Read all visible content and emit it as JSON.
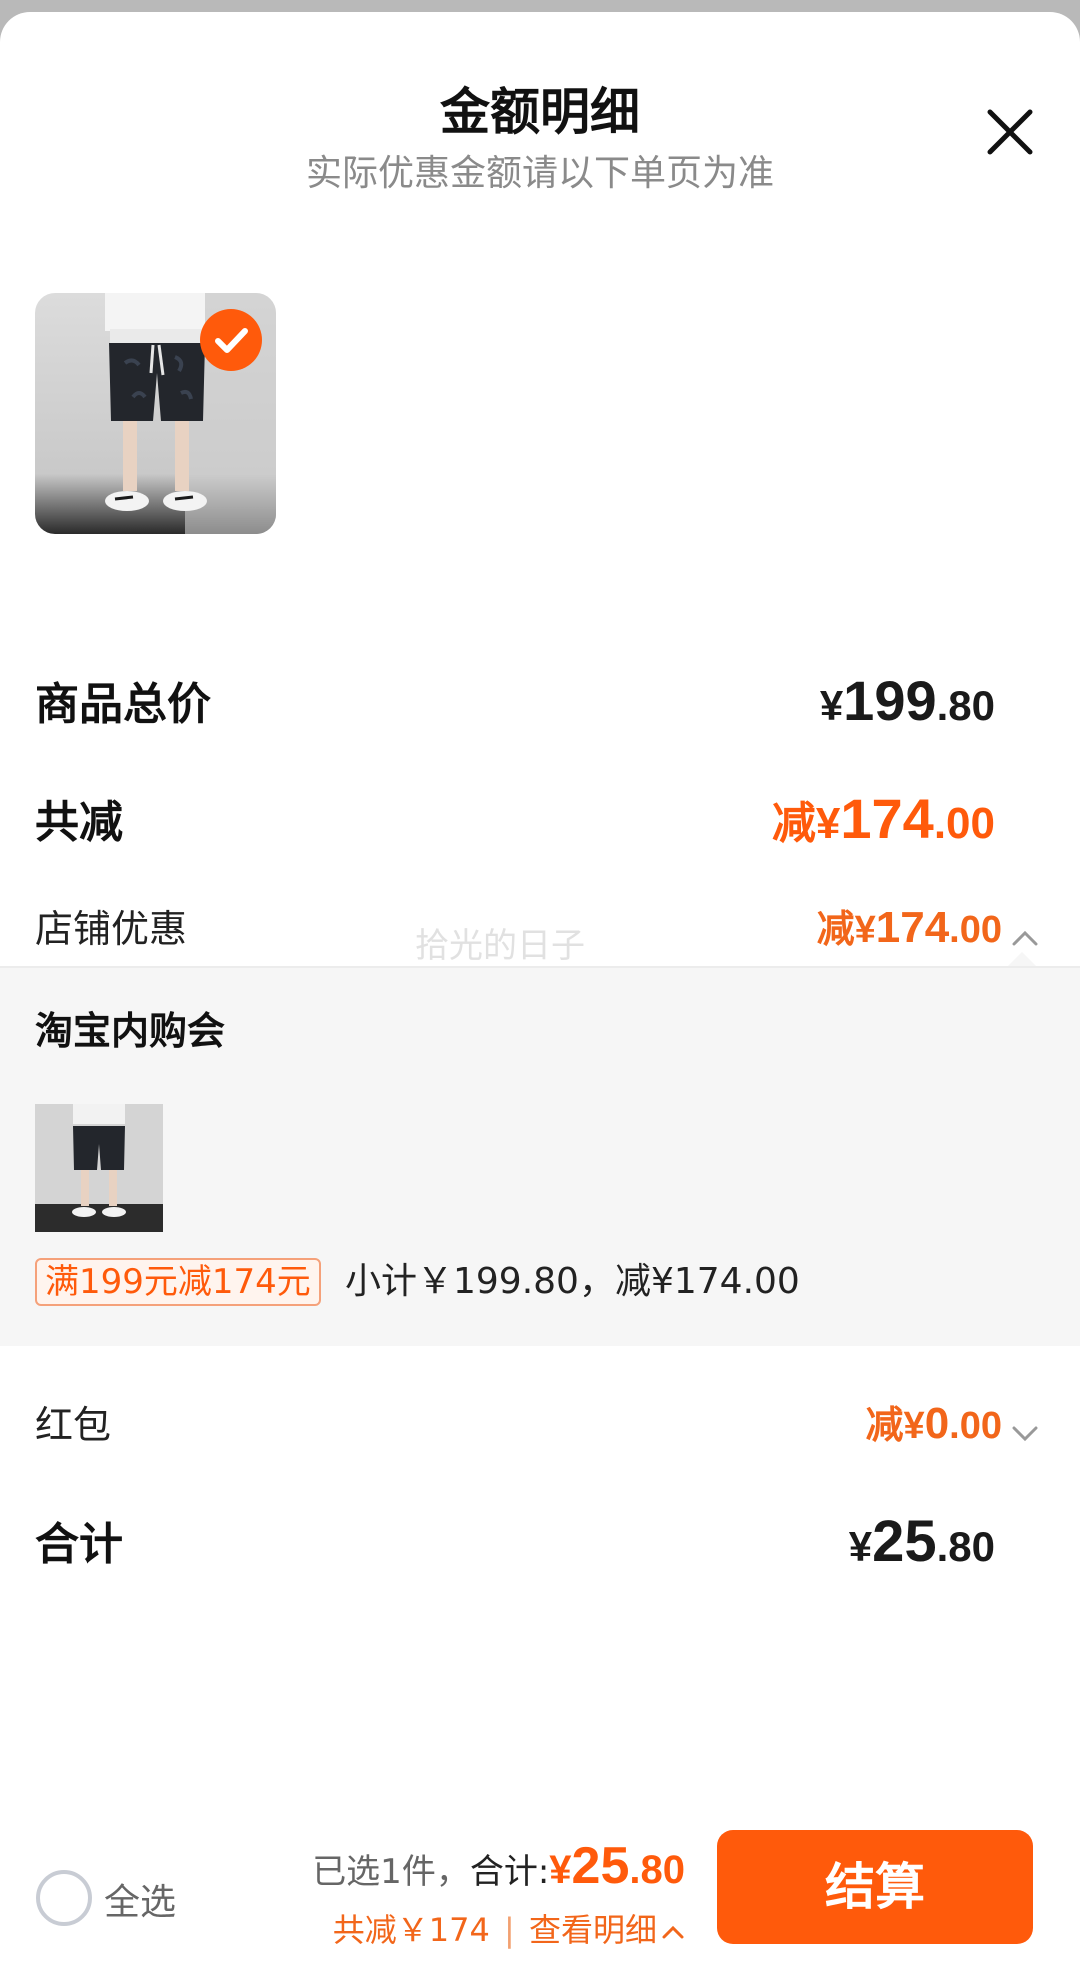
{
  "header": {
    "title": "金额明细",
    "subtitle": "实际优惠金额请以下单页为准"
  },
  "icons": {
    "close": "close-icon",
    "check": "check-icon",
    "chevron_up": "chevron-up-icon",
    "chevron_down": "chevron-down-icon"
  },
  "colors": {
    "accent": "#ff5a0b",
    "text": "#1a1a1a",
    "muted": "#8a8a8a",
    "panel_bg": "#f6f6f6"
  },
  "product": {
    "selected": true
  },
  "summary": {
    "goods_total": {
      "label": "商品总价",
      "currency": "¥",
      "integer": "199",
      "decimal": ".80"
    },
    "total_discount": {
      "label": "共减",
      "prefix": "减¥",
      "integer": "174",
      "decimal": ".00"
    },
    "store_discount": {
      "label": "店铺优惠",
      "prefix": "减¥",
      "integer": "174",
      "decimal": ".00",
      "expanded": true
    },
    "red_packet": {
      "label": "红包",
      "prefix": "减¥",
      "integer": "0",
      "decimal": ".00",
      "expanded": false
    },
    "grand_total": {
      "label": "合计",
      "currency": "¥",
      "integer": "25",
      "decimal": ".80"
    }
  },
  "watermark": "拾光的日子",
  "promo": {
    "title": "淘宝内购会",
    "tag": "满199元减174元",
    "subtotal_text": "小计￥199.80，减¥174.00"
  },
  "bottom_bar": {
    "select_all": "全选",
    "selected_count": "已选1件，",
    "total_label": "合计:",
    "total_currency": "¥",
    "total_integer": "25",
    "total_decimal": ".80",
    "discount_text": "共减￥174",
    "separator": "|",
    "view_detail": "查看明细",
    "checkout": "结算"
  }
}
